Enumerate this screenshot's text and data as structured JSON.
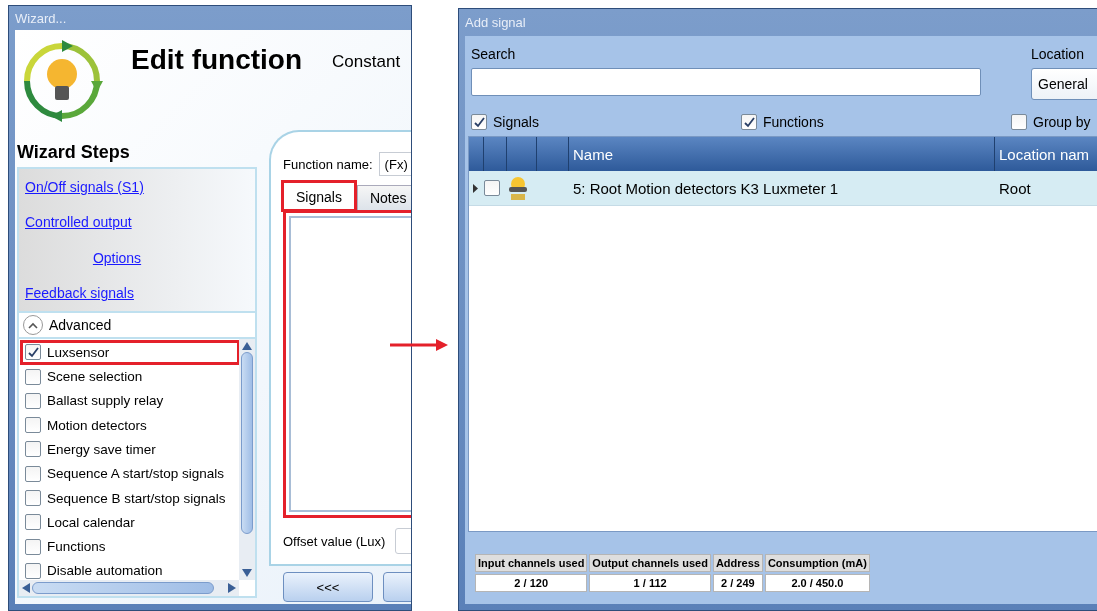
{
  "wizard": {
    "title": "Wizard...",
    "heading": "Edit function",
    "subtitle": "Constant",
    "steps_title": "Wizard Steps",
    "steps": [
      {
        "label": "On/Off signals (S1)",
        "kind": "step"
      },
      {
        "label": "Controlled output",
        "kind": "step"
      },
      {
        "label": "Options",
        "kind": "sub"
      },
      {
        "label": "Feedback signals",
        "kind": "step"
      }
    ],
    "advanced": {
      "label": "Advanced",
      "expanded": true
    },
    "options": [
      {
        "label": "Luxsensor",
        "checked": true,
        "highlighted": true
      },
      {
        "label": "Scene selection",
        "checked": false,
        "highlighted": false
      },
      {
        "label": "Ballast supply relay",
        "checked": false,
        "highlighted": false
      },
      {
        "label": "Motion detectors",
        "checked": false,
        "highlighted": false
      },
      {
        "label": "Energy save timer",
        "checked": false,
        "highlighted": false
      },
      {
        "label": "Sequence A start/stop signals",
        "checked": false,
        "highlighted": false
      },
      {
        "label": "Sequence B start/stop signals",
        "checked": false,
        "highlighted": false
      },
      {
        "label": "Local calendar",
        "checked": false,
        "highlighted": false
      },
      {
        "label": "Functions",
        "checked": false,
        "highlighted": false
      },
      {
        "label": "Disable automation",
        "checked": false,
        "highlighted": false
      }
    ],
    "function_name": {
      "label": "Function name:",
      "value": "(Fx)"
    },
    "tabs": [
      {
        "label": "Signals",
        "selected": true
      },
      {
        "label": "Notes",
        "selected": false
      }
    ],
    "tab_panel": {
      "highlighted": true
    },
    "offset": {
      "label": "Offset value (Lux)"
    },
    "buttons": [
      "<<<"
    ]
  },
  "add_signal": {
    "title": "Add signal",
    "search": {
      "label": "Search"
    },
    "location": {
      "label": "Location",
      "value": "General"
    },
    "filters": [
      {
        "label": "Signals",
        "checked": true
      },
      {
        "label": "Functions",
        "checked": true
      },
      {
        "label": "Group by",
        "checked": false
      }
    ],
    "columns": [
      "Name",
      "Location nam"
    ],
    "rows": [
      {
        "name": "5: Root Motion detectors K3 Luxmeter 1",
        "location": "Root",
        "checked": false,
        "selected": true
      }
    ],
    "stats": [
      {
        "label": "Input channels used",
        "value": "2 / 120"
      },
      {
        "label": "Output channels used",
        "value": "1 / 112"
      },
      {
        "label": "Address",
        "value": "2 / 249"
      },
      {
        "label": "Consumption (mA)",
        "value": "2.0 / 450.0"
      }
    ]
  }
}
